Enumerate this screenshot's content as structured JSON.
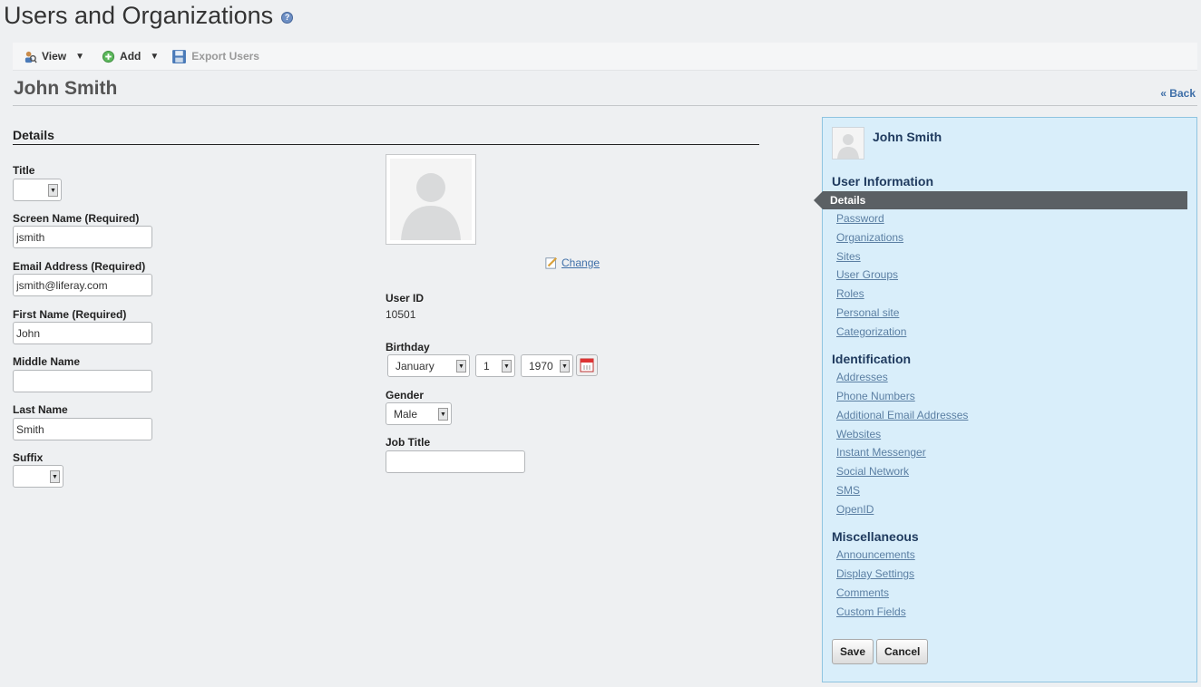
{
  "page": {
    "title": "Users and Organizations",
    "help_icon": "help-icon"
  },
  "toolbar": {
    "view_label": "View",
    "add_label": "Add",
    "export_label": "Export Users"
  },
  "user_heading": "John Smith",
  "back_label": "« Back",
  "details": {
    "section_title": "Details",
    "title_label": "Title",
    "title_value": "",
    "screen_name_label": "Screen Name (Required)",
    "screen_name_value": "jsmith",
    "email_label": "Email Address (Required)",
    "email_value": "jsmith@liferay.com",
    "first_name_label": "First Name (Required)",
    "first_name_value": "John",
    "middle_name_label": "Middle Name",
    "middle_name_value": "",
    "last_name_label": "Last Name",
    "last_name_value": "Smith",
    "suffix_label": "Suffix",
    "suffix_value": "",
    "change_label": "Change",
    "user_id_label": "User ID",
    "user_id_value": "10501",
    "birthday_label": "Birthday",
    "birthday_month": "January",
    "birthday_day": "1",
    "birthday_year": "1970",
    "gender_label": "Gender",
    "gender_value": "Male",
    "job_title_label": "Job Title",
    "job_title_value": ""
  },
  "sidebar": {
    "user_name": "John Smith",
    "user_information_title": "User Information",
    "user_information_items": [
      "Details",
      "Password",
      "Organizations",
      "Sites",
      "User Groups",
      "Roles",
      "Personal site",
      "Categorization"
    ],
    "identification_title": "Identification",
    "identification_items": [
      "Addresses",
      "Phone Numbers",
      "Additional Email Addresses",
      "Websites",
      "Instant Messenger",
      "Social Network",
      "SMS",
      "OpenID"
    ],
    "miscellaneous_title": "Miscellaneous",
    "miscellaneous_items": [
      "Announcements",
      "Display Settings",
      "Comments",
      "Custom Fields"
    ],
    "save_label": "Save",
    "cancel_label": "Cancel"
  },
  "colors": {
    "accent_link": "#3f6fa8",
    "panel_bg": "#d9eefa",
    "active_item_bg": "#5b6064"
  }
}
